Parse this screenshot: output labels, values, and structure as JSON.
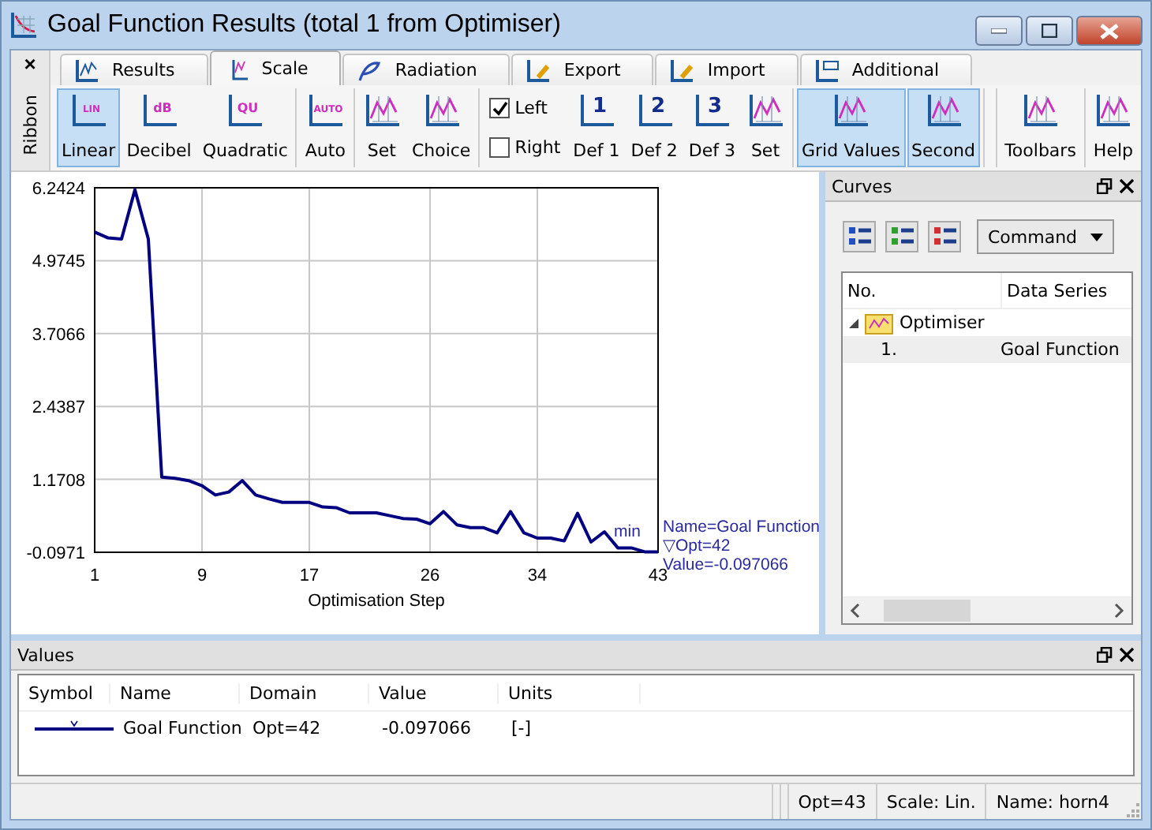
{
  "window": {
    "title": "Goal Function Results (total 1 from Optimiser)"
  },
  "ribbon": {
    "label": "Ribbon",
    "close": "×",
    "tabs": [
      {
        "label": "Results",
        "selected": false
      },
      {
        "label": "Scale",
        "selected": true
      },
      {
        "label": "Radiation",
        "selected": false
      },
      {
        "label": "Export",
        "selected": false
      },
      {
        "label": "Import",
        "selected": false
      },
      {
        "label": "Additional",
        "selected": false
      }
    ],
    "groups": [
      {
        "items": [
          {
            "kind": "button",
            "label": "Linear",
            "glyph": "LIN",
            "selected": true
          },
          {
            "kind": "button",
            "label": "Decibel",
            "glyph": "dB",
            "selected": false
          },
          {
            "kind": "button",
            "label": "Quadratic",
            "glyph": "QU",
            "selected": false
          }
        ]
      },
      {
        "items": [
          {
            "kind": "button",
            "label": "Auto",
            "glyph": "AUTO",
            "selected": false
          }
        ]
      },
      {
        "items": [
          {
            "kind": "button",
            "label": "Set",
            "selected": false
          },
          {
            "kind": "button",
            "label": "Choice",
            "selected": false
          }
        ]
      },
      {
        "items": [
          {
            "kind": "checks",
            "options": [
              {
                "label": "Left",
                "checked": true
              },
              {
                "label": "Right",
                "checked": false
              }
            ]
          },
          {
            "kind": "button",
            "label": "Def 1",
            "glyph": "1",
            "selected": false
          },
          {
            "kind": "button",
            "label": "Def 2",
            "glyph": "2",
            "selected": false
          },
          {
            "kind": "button",
            "label": "Def 3",
            "glyph": "3",
            "selected": false
          },
          {
            "kind": "button",
            "label": "Set",
            "selected": false
          }
        ]
      },
      {
        "items": [
          {
            "kind": "button",
            "label": "Grid Values",
            "selected": true
          },
          {
            "kind": "button",
            "label": "Second",
            "selected": true
          }
        ]
      }
    ],
    "right_groups": [
      {
        "items": [
          {
            "kind": "button",
            "label": "Toolbars",
            "selected": false
          }
        ]
      },
      {
        "items": [
          {
            "kind": "button",
            "label": "Help",
            "selected": false
          }
        ]
      }
    ]
  },
  "plot": {
    "marker": {
      "min_label": "min",
      "lines": [
        "Name=Goal Function",
        "▽Opt=42",
        "Value=-0.097066"
      ]
    },
    "chart_data": {
      "type": "line",
      "grid": true,
      "xlabel": "Optimisation Step",
      "xlim": [
        1,
        43
      ],
      "ylim": [
        -0.0971,
        6.2424
      ],
      "xticks": [
        1,
        9,
        17,
        26,
        34,
        43
      ],
      "yticks": [
        -0.0971,
        1.1708,
        2.4387,
        3.7066,
        4.9745,
        6.2424
      ],
      "x": [
        1,
        2,
        3,
        4,
        5,
        6,
        7,
        8,
        9,
        10,
        11,
        12,
        13,
        14,
        15,
        16,
        17,
        18,
        19,
        20,
        21,
        22,
        23,
        24,
        25,
        26,
        27,
        28,
        29,
        30,
        31,
        32,
        33,
        34,
        35,
        36,
        37,
        38,
        39,
        40,
        41,
        42,
        43
      ],
      "series": [
        {
          "color": "#000080",
          "values": [
            5.47,
            5.37,
            5.35,
            6.21,
            5.35,
            1.21,
            1.19,
            1.15,
            1.06,
            0.9,
            0.95,
            1.15,
            0.9,
            0.83,
            0.77,
            0.77,
            0.77,
            0.69,
            0.68,
            0.59,
            0.59,
            0.59,
            0.54,
            0.49,
            0.48,
            0.4,
            0.61,
            0.38,
            0.33,
            0.33,
            0.24,
            0.61,
            0.24,
            0.15,
            0.15,
            0.1,
            0.58,
            0.08,
            0.26,
            -0.02,
            -0.02,
            -0.09,
            -0.09
          ]
        }
      ]
    }
  },
  "curves": {
    "title": "Curves",
    "command": "Command",
    "columns": [
      "No.",
      "Data Series"
    ],
    "tree": [
      {
        "label": "Optimiser",
        "expanded": true,
        "children": [
          {
            "no": "1.",
            "series": "Goal Function",
            "selected": true
          }
        ]
      }
    ]
  },
  "values": {
    "title": "Values",
    "columns": [
      "Symbol",
      "Name",
      "Domain",
      "Value",
      "Units"
    ],
    "rows": [
      {
        "name": "Goal Function",
        "domain": "Opt=42",
        "value": "-0.097066",
        "units": "[-]"
      }
    ]
  },
  "status_bar": [
    "Opt=43",
    "Scale: Lin.",
    "Name: horn4"
  ]
}
